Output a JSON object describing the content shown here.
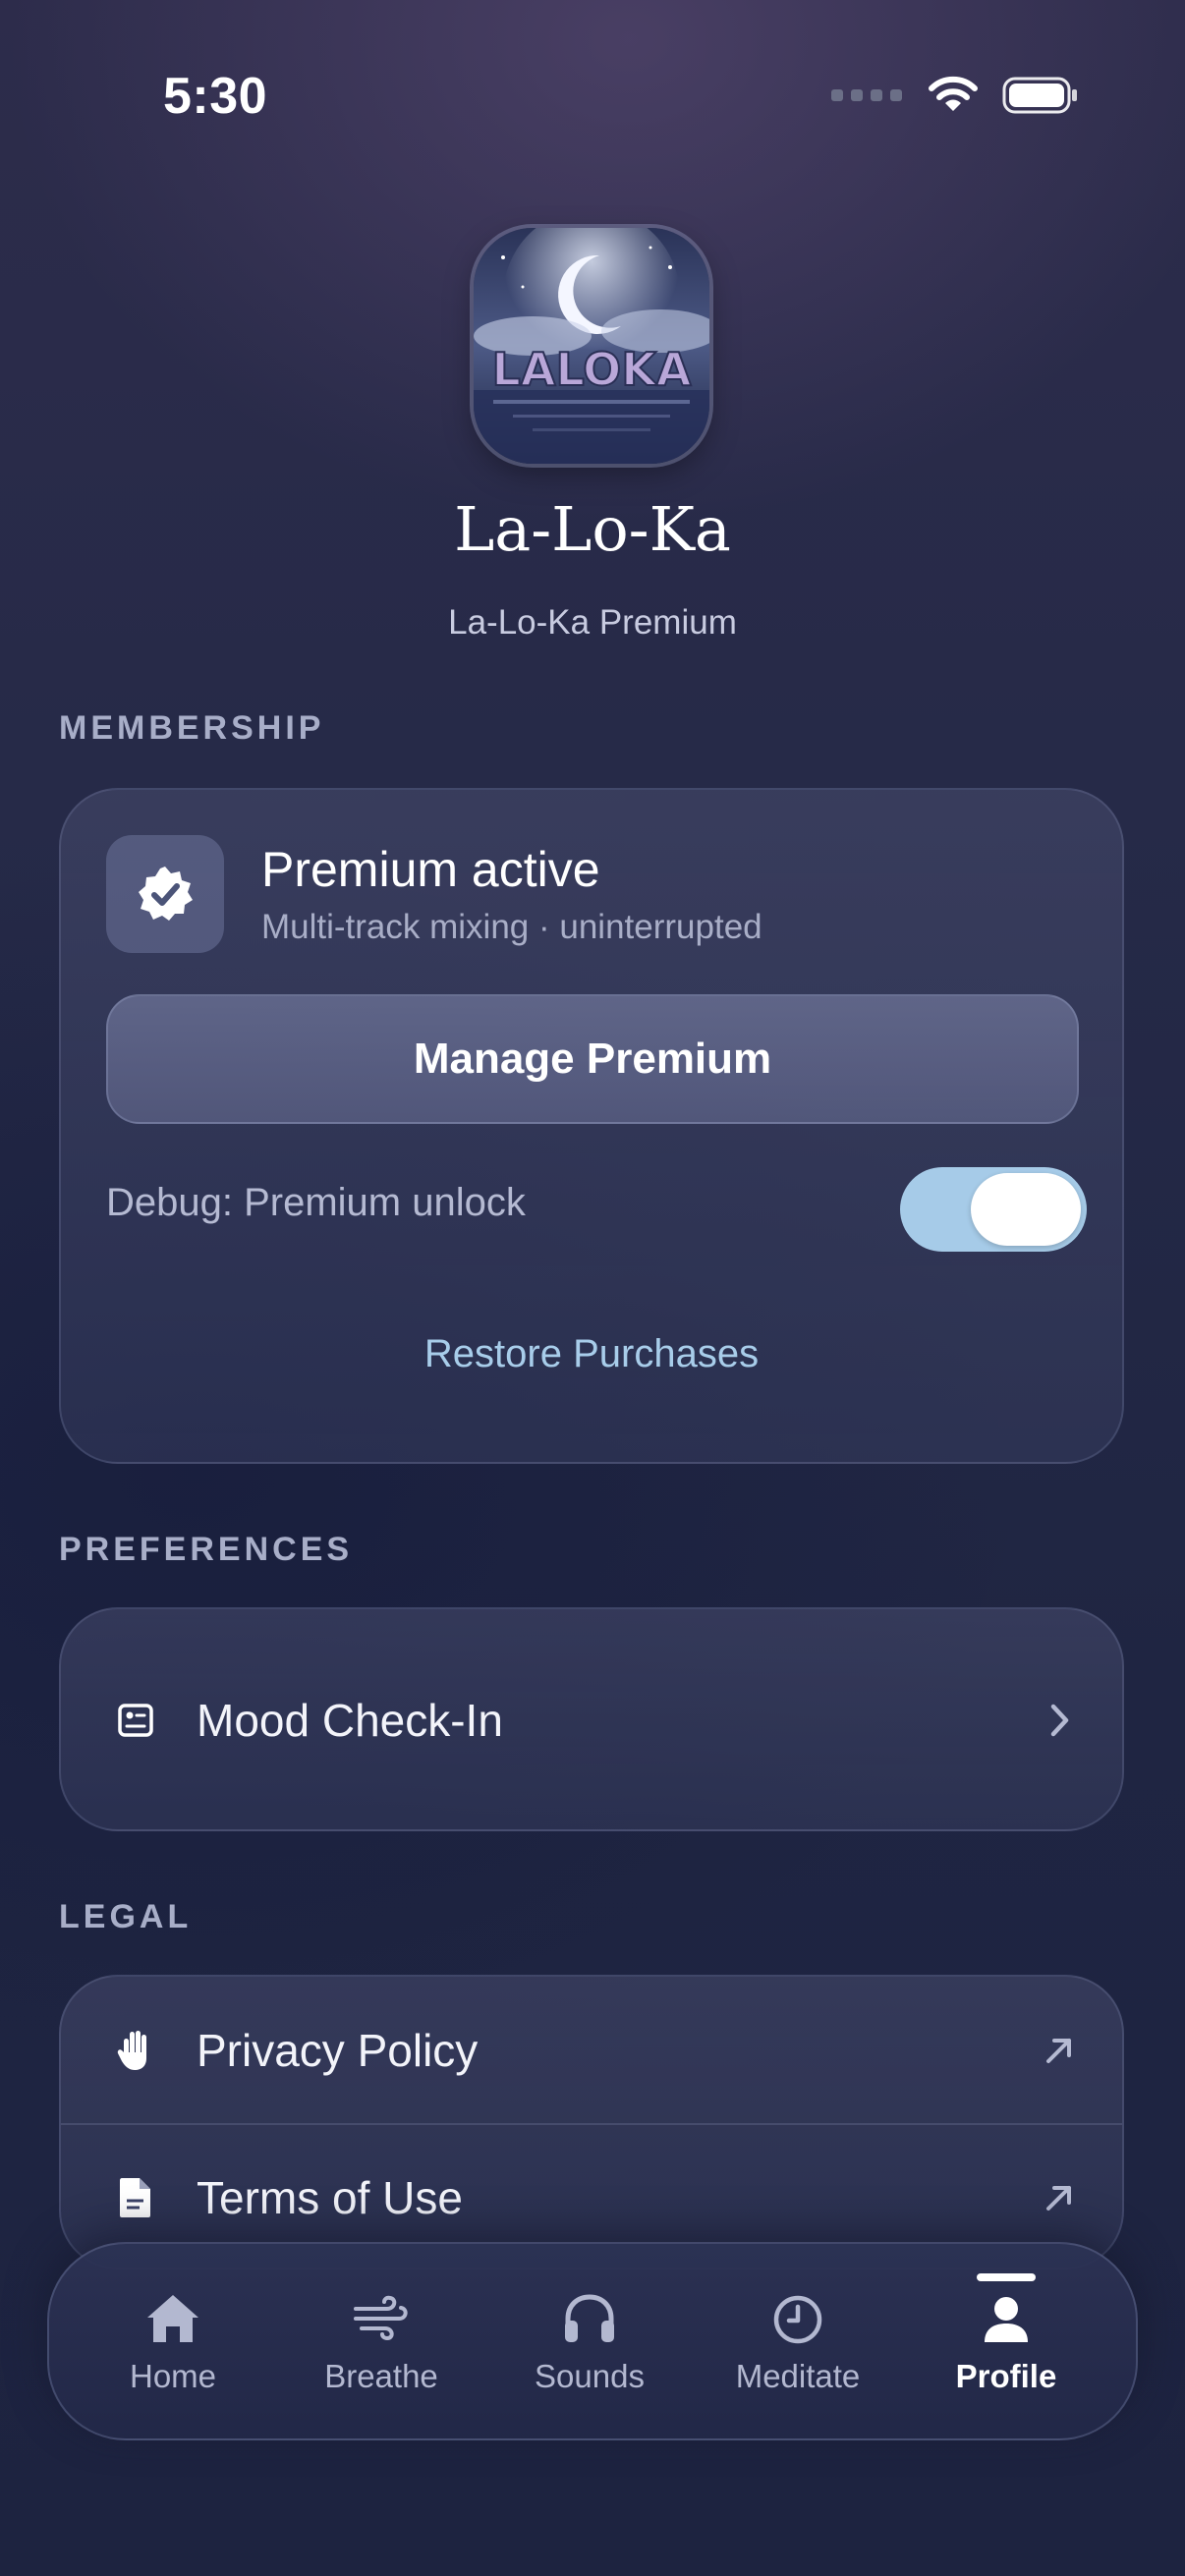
{
  "status_bar": {
    "time": "5:30"
  },
  "header": {
    "app_name": "La-Lo-Ka",
    "subtitle": "La-Lo-Ka Premium",
    "icon_letters": "LALOKA"
  },
  "membership": {
    "section_title": "MEMBERSHIP",
    "badge_icon": "verified-badge-icon",
    "title": "Premium active",
    "subtitle": "Multi-track mixing · uninterrupted",
    "manage_button": "Manage Premium",
    "debug_label": "Debug: Premium unlock",
    "debug_toggle_on": true,
    "restore_label": "Restore Purchases"
  },
  "preferences": {
    "section_title": "PREFERENCES",
    "items": [
      {
        "label": "Mood Check-In",
        "icon": "checkin-card-icon",
        "trailing": "chevron-right-icon"
      }
    ]
  },
  "legal": {
    "section_title": "LEGAL",
    "items": [
      {
        "label": "Privacy Policy",
        "icon": "hand-icon",
        "trailing": "external-link-icon"
      },
      {
        "label": "Terms of Use",
        "icon": "document-icon",
        "trailing": "external-link-icon"
      }
    ]
  },
  "tab_bar": {
    "active": "Profile",
    "tabs": [
      {
        "label": "Home",
        "icon": "home-icon"
      },
      {
        "label": "Breathe",
        "icon": "wind-icon"
      },
      {
        "label": "Sounds",
        "icon": "headphones-icon"
      },
      {
        "label": "Meditate",
        "icon": "clock-icon"
      },
      {
        "label": "Profile",
        "icon": "person-icon"
      }
    ]
  },
  "colors": {
    "accent": "#a8cdea",
    "toggle_on": "#a6cbe8",
    "background_top": "#2d2c4b",
    "background_bottom": "#1d2340"
  }
}
